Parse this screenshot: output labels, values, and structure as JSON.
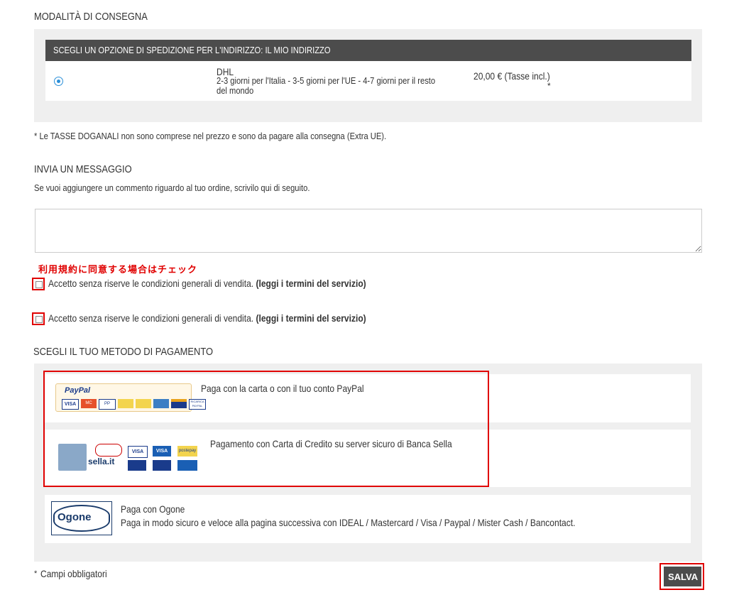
{
  "delivery": {
    "title": "MODALITÀ DI CONSEGNA",
    "header": "SCEGLI UN OPZIONE DI SPEDIZIONE PER L'INDIRIZZO: IL MIO INDIRIZZO",
    "carrier": "DHL",
    "description_line1": "2-3 giorni per l'Italia - 3-5 giorni per l'UE - 4-7 giorni per il resto",
    "description_line2": "del mondo",
    "price": "20,00 € (Tasse incl.)",
    "price_mark": "*",
    "customs_note": "* Le TASSE DOGANALI non sono comprese nel prezzo e sono da pagare alla consegna (Extra UE)."
  },
  "message": {
    "title": "INVIA UN MESSAGGIO",
    "subtitle": "Se vuoi aggiungere un commento riguardo al tuo ordine, scrivilo qui di seguito.",
    "value": ""
  },
  "terms": {
    "annotation": "利用規約に同意する場合はチェック",
    "label": "Accetto senza riserve le condizioni generali di vendita.",
    "link": "(leggi i termini del servizio)"
  },
  "payment": {
    "title": "SCEGLI IL TUO METODO DI PAGAMENTO",
    "paypal_text": "Paga con la carta o con il tuo conto PayPal",
    "paypal_logo": "PayPal",
    "paypal_cards": [
      "VISA",
      "MC",
      "PP",
      "",
      "",
      "",
      "",
      "RICARICA PAYPAL"
    ],
    "sella_text": "Pagamento con Carta di Credito su server sicuro di Banca Sella",
    "sella_logo": "sella.it",
    "sella_cards": [
      "VISA",
      "VISA",
      "postepay",
      "",
      "",
      ""
    ],
    "ogone_title": "Paga con Ogone",
    "ogone_text": "Paga in modo sicuro e veloce alla pagina successiva con IDEAL / Mastercard / Visa / Paypal / Mister Cash / Bancontact.",
    "ogone_logo": "Ogone"
  },
  "footer": {
    "required": "Campi obbligatori",
    "required_mark": "*",
    "save": "SALVA"
  },
  "colors": {
    "header_bg": "#4c4c4c",
    "panel_bg": "#efefef",
    "annotation_red": "#e00000",
    "radio_blue": "#2b8fd8"
  }
}
